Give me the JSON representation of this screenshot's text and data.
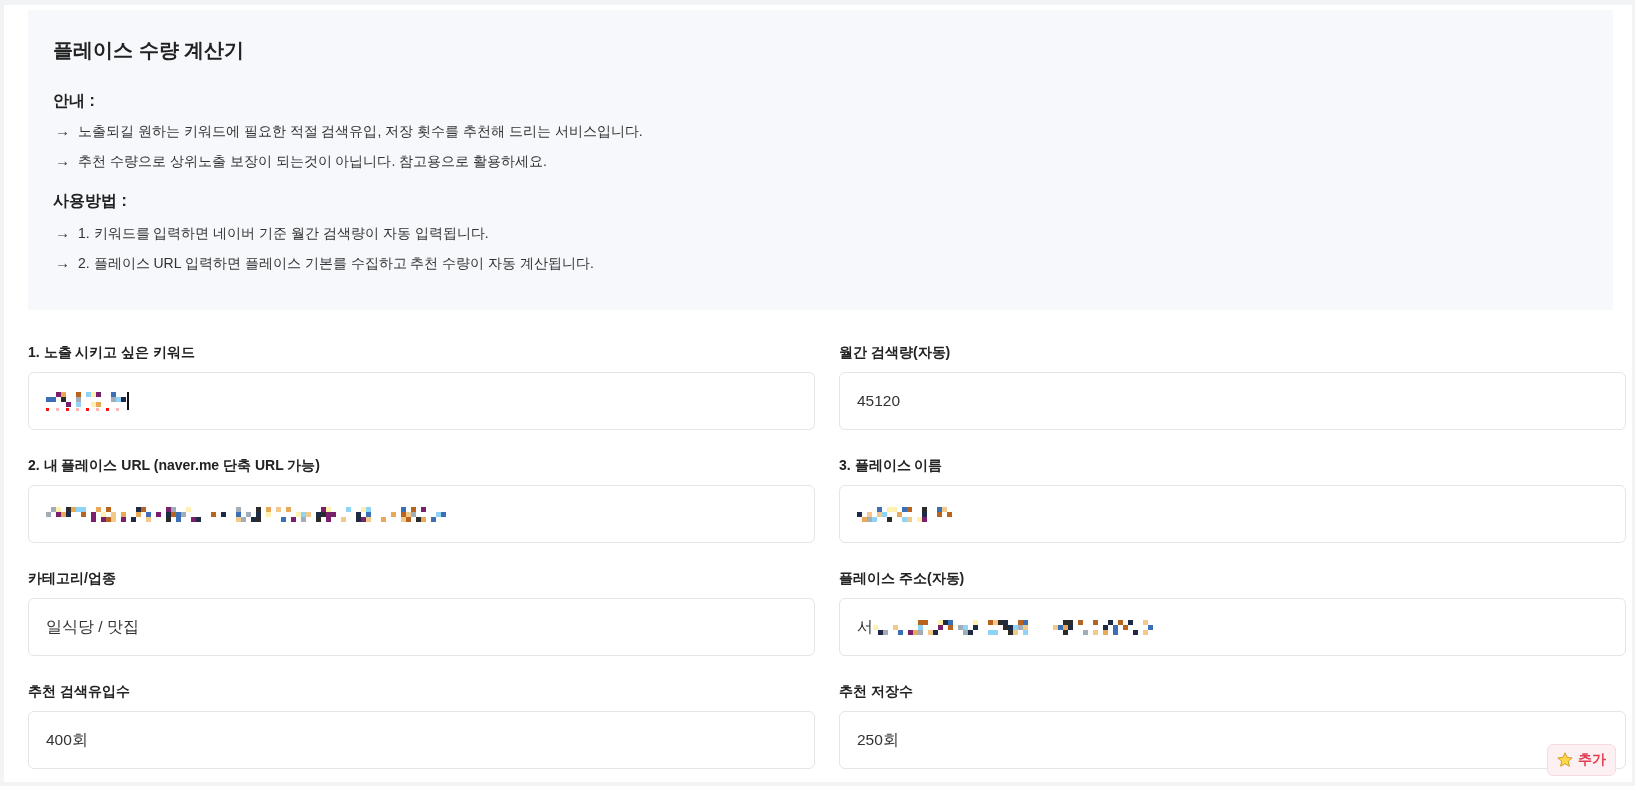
{
  "info_panel": {
    "title": "플레이스 수량 계산기",
    "sections": [
      {
        "heading": "안내 :",
        "items": [
          {
            "marker": "→",
            "text": "노출되길 원하는 키워드에 필요한 적절 검색유입, 저장 횟수를 추천해 드리는 서비스입니다."
          },
          {
            "marker": "→",
            "text": "추천 수량으로 상위노출 보장이 되는것이 아닙니다. 참고용으로 활용하세요."
          }
        ]
      },
      {
        "heading": "사용방법 :",
        "items": [
          {
            "marker": "→",
            "text": "1. 키워드를 입력하면 네이버 기준 월간 검색량이 자동 입력됩니다."
          },
          {
            "marker": "→",
            "text": "2. 플레이스 URL 입력하면 플레이스 기본를 수집하고 추천 수량이 자동 계산됩니다."
          }
        ]
      }
    ]
  },
  "form": {
    "fields": [
      {
        "label": "1. 노출 시키고 싶은 키워드",
        "redacted": true,
        "focused": true
      },
      {
        "label": "월간 검색량(자동)",
        "value": "45120",
        "redacted": false,
        "focused": false
      },
      {
        "label": "2. 내 플레이스 URL (naver.me 단축 URL 가능)",
        "redacted": true,
        "focused": false
      },
      {
        "label": "3. 플레이스 이름",
        "redacted": true,
        "focused": false
      },
      {
        "label": "카테고리/업종",
        "value": "일식당 / 맛집",
        "redacted": false,
        "focused": false
      },
      {
        "label": "플레이스 주소(자동)",
        "value": "서",
        "redacted": true,
        "focused": false
      },
      {
        "label": "추천 검색유입수",
        "value": "400회",
        "redacted": false,
        "focused": false
      },
      {
        "label": "추천 저장수",
        "value": "250회",
        "redacted": false,
        "focused": false
      }
    ]
  },
  "add_button": {
    "label": "추가"
  }
}
